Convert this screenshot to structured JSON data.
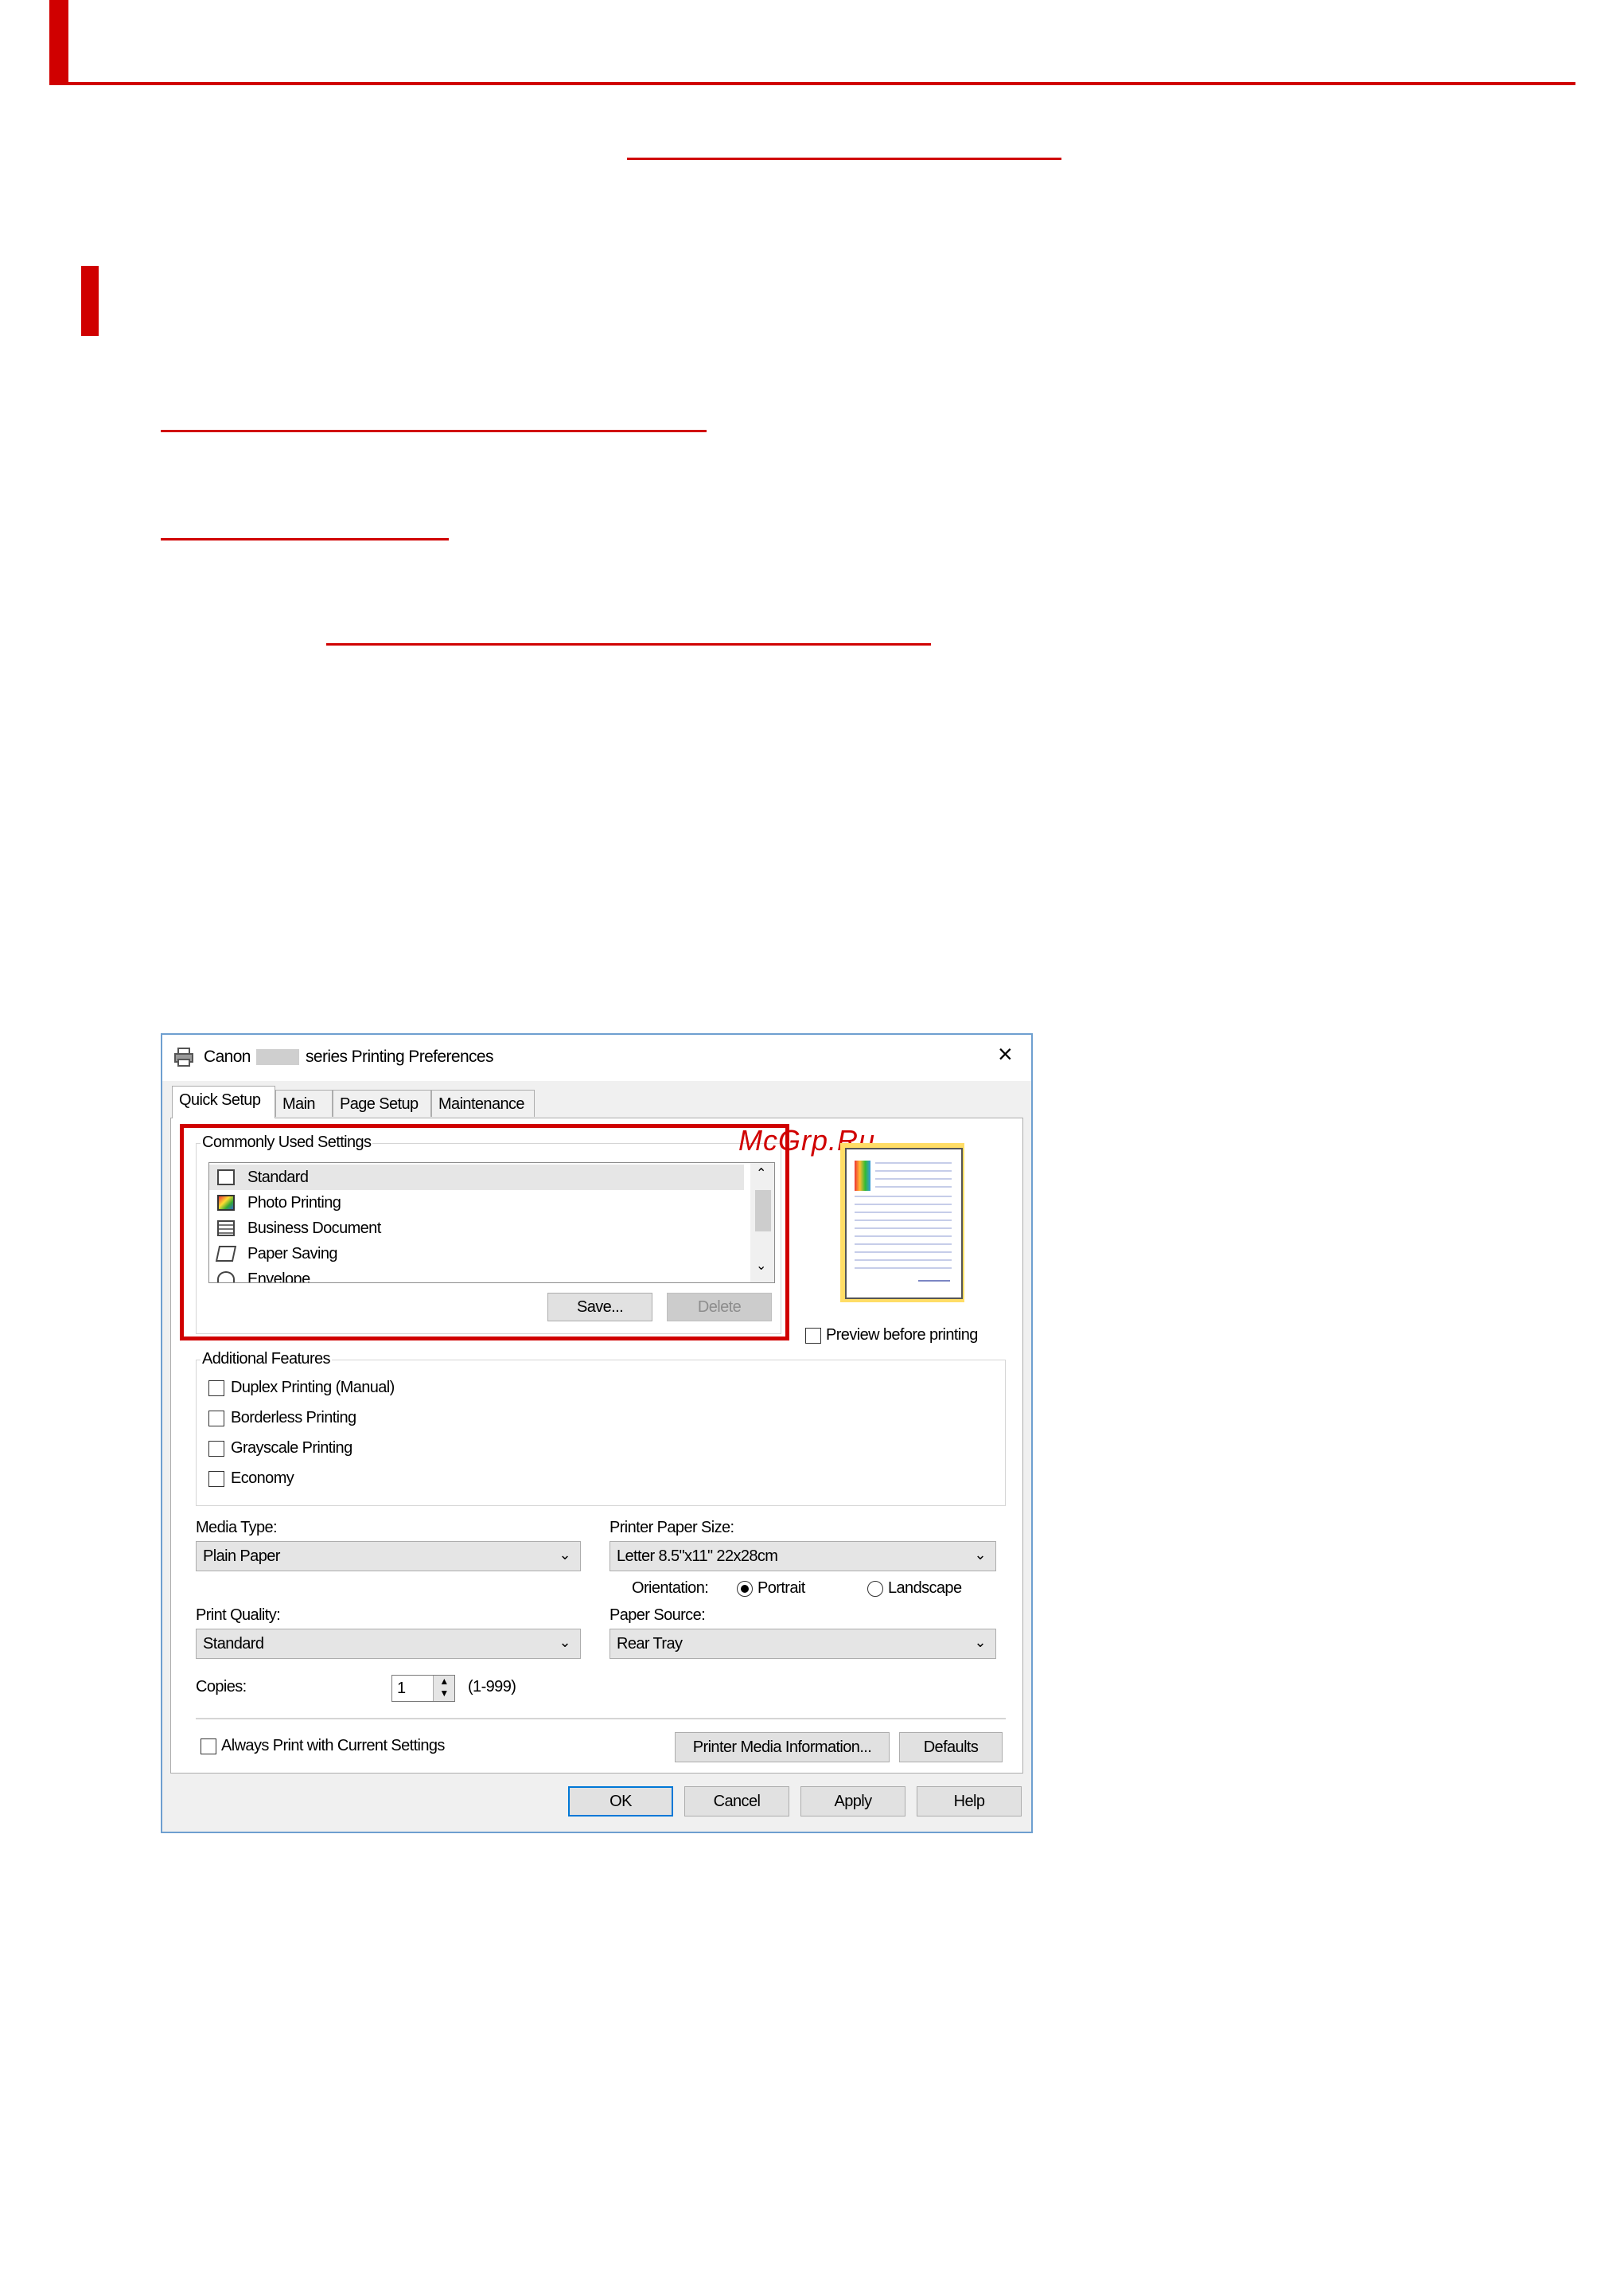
{
  "dialog": {
    "title_prefix": "Canon",
    "title_suffix": "series Printing Preferences",
    "close_glyph": "×",
    "tabs": [
      {
        "label": "Quick Setup",
        "active": true
      },
      {
        "label": "Main",
        "active": false
      },
      {
        "label": "Page Setup",
        "active": false
      },
      {
        "label": "Maintenance",
        "active": false
      }
    ],
    "common": {
      "label": "Commonly Used Settings",
      "items": [
        {
          "label": "Standard",
          "selected": true,
          "icon": "standard-icon"
        },
        {
          "label": "Photo Printing",
          "selected": false,
          "icon": "photo-icon"
        },
        {
          "label": "Business Document",
          "selected": false,
          "icon": "document-icon"
        },
        {
          "label": "Paper Saving",
          "selected": false,
          "icon": "paper-saving-icon"
        },
        {
          "label": "Envelope",
          "selected": false,
          "icon": "envelope-icon"
        }
      ],
      "save_label": "Save...",
      "delete_label": "Delete"
    },
    "watermark": "McGrp.Ru",
    "preview_label": "Preview before printing",
    "additional": {
      "label": "Additional Features",
      "items": [
        "Duplex Printing (Manual)",
        "Borderless Printing",
        "Grayscale Printing",
        "Economy"
      ]
    },
    "media_type": {
      "label": "Media Type:",
      "value": "Plain Paper"
    },
    "paper_size": {
      "label": "Printer Paper Size:",
      "value": "Letter 8.5\"x11\" 22x28cm"
    },
    "orientation": {
      "label": "Orientation:",
      "portrait": "Portrait",
      "landscape": "Landscape",
      "selected": "Portrait"
    },
    "print_quality": {
      "label": "Print Quality:",
      "value": "Standard"
    },
    "paper_source": {
      "label": "Paper Source:",
      "value": "Rear Tray"
    },
    "copies": {
      "label": "Copies:",
      "value": "1",
      "range": "(1-999)"
    },
    "always_print_label": "Always Print with Current Settings",
    "media_info_label": "Printer Media Information...",
    "defaults_label": "Defaults",
    "buttons": {
      "ok": "OK",
      "cancel": "Cancel",
      "apply": "Apply",
      "help": "Help"
    },
    "colors": {
      "accent": "#d00000",
      "border": "#6e9fd0"
    }
  }
}
